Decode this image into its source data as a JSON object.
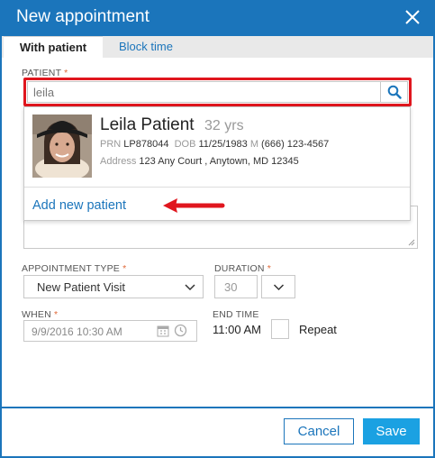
{
  "dialog": {
    "title": "New appointment",
    "tabs": [
      {
        "label": "With patient",
        "active": true
      },
      {
        "label": "Block time",
        "active": false
      }
    ]
  },
  "patient": {
    "label": "PATIENT",
    "required_mark": "*",
    "search_value": "leila",
    "results": [
      {
        "name": "Leila Patient",
        "age": "32 yrs",
        "prn_label": "PRN",
        "prn": "LP878044",
        "dob_label": "DOB",
        "dob": "11/25/1983",
        "phone_label": "M",
        "phone": "(666) 123-4567",
        "address_label": "Address",
        "address": "123 Any Court , Anytown, MD 12345"
      }
    ],
    "add_new_label": "Add new patient"
  },
  "appointment_type": {
    "label": "APPOINTMENT TYPE",
    "required_mark": "*",
    "value": "New Patient Visit"
  },
  "duration": {
    "label": "DURATION",
    "required_mark": "*",
    "value": "30"
  },
  "when": {
    "label": "WHEN",
    "required_mark": "*",
    "value": "9/9/2016 10:30 AM"
  },
  "end_time": {
    "label": "END TIME",
    "value": "11:00 AM"
  },
  "repeat": {
    "label": "Repeat",
    "checked": false
  },
  "footer": {
    "cancel_label": "Cancel",
    "save_label": "Save"
  },
  "colors": {
    "primary": "#1b75bb",
    "save": "#1ba1e2",
    "highlight": "#e0161e",
    "required": "#e06a3a"
  },
  "icons": [
    "close-icon",
    "search-icon",
    "chevron-down-icon",
    "calendar-icon",
    "clock-icon",
    "arrow-left-icon"
  ]
}
